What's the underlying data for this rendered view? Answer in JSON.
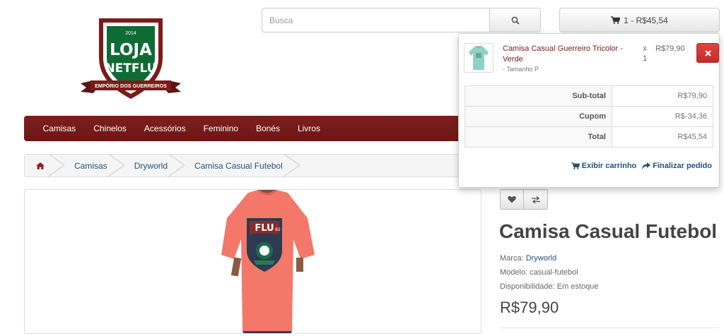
{
  "logo": {
    "year": "2014",
    "line1": "LOJA",
    "line2": "NETFLU",
    "ribbon": "EMPÓRIO DOS GUERREIROS"
  },
  "search": {
    "placeholder": "Busca",
    "icon": "search-icon"
  },
  "cart": {
    "summary": "1 - R$45,54",
    "icon": "cart-icon"
  },
  "menu": [
    "Camisas",
    "Chinelos",
    "Acessórios",
    "Feminino",
    "Bonés",
    "Livros"
  ],
  "breadcrumb": {
    "home_icon": "home-icon",
    "items": [
      "Camisas",
      "Dryworld",
      "Camisa Casual Futebol"
    ]
  },
  "cart_dropdown": {
    "item": {
      "name": "Camisa Casual Guerreiro Tricolor - Verde",
      "option": "- Tamanho P",
      "times": "x",
      "qty": "1",
      "price": "R$79,90"
    },
    "totals": [
      {
        "label": "Sub-total",
        "value": "R$79,90"
      },
      {
        "label": "Cupom",
        "value": "R$-34,36"
      },
      {
        "label": "Total",
        "value": "R$45,54"
      }
    ],
    "view_cart": "Exibir carrinho",
    "checkout": "Finalizar pedido"
  },
  "product": {
    "shirt_print": "FLU",
    "shirt_print_num": "82",
    "title": "Camisa Casual Futebol",
    "brand_label": "Marca:",
    "brand": "Dryworld",
    "model_label": "Modelo:",
    "model": "casual-futebol",
    "availability_label": "Disponibilidade:",
    "availability": "Em estoque",
    "price": "R$79,90"
  },
  "colors": {
    "brand": "#7a1c1a",
    "link": "#23527c",
    "danger": "#d9534f",
    "logo_green": "#0f6b34"
  }
}
